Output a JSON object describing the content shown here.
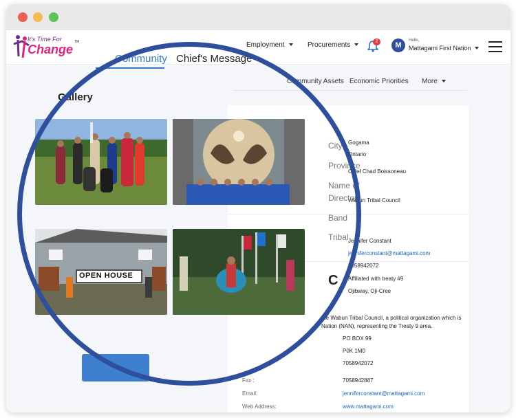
{
  "window": {
    "controls": [
      "close",
      "minimize",
      "maximize"
    ]
  },
  "logo": {
    "line1": "It's Time For",
    "line2": "Change",
    "tm": "TM"
  },
  "topnav": {
    "employment": "Employment",
    "procurements": "Procurements",
    "notification_count": "2",
    "hello": "Hello,",
    "org_name": "Mattagami First Nation"
  },
  "tabs": {
    "community": "Community",
    "chiefs_message": "Chief's Message"
  },
  "subnav": {
    "community_assets": "Community Assets",
    "economic_priorities": "Economic Priorities",
    "more": "More"
  },
  "gallery": {
    "title": "Gallery"
  },
  "details": {
    "city_label": "City",
    "province_label": "Province",
    "name_label": "Name of",
    "director_label": "Director",
    "band_label": "Band",
    "tribal_label": "Tribal",
    "first_value": "Gogama",
    "province_value": "Ontario",
    "name_value": "Chief Chad Boissoneau",
    "tribal_council_value": "Wabun Tribal Council",
    "contact_value": "Jennifer Constant",
    "email_value_top": "jenniferconstant@mattagami.com",
    "phone_value_top": "7058942072",
    "treaty_value": "Affiliated with treaty #9",
    "language_value": "Ojibway, Oji-Cree",
    "section_initial": "C"
  },
  "description": {
    "line1": "the Wabun Tribal Council, a political organization which is",
    "line2": "Nation (NAN), representing the Treaty 9 area."
  },
  "contact": {
    "address": "PO BOX 99",
    "postal": "P0K 1M0",
    "phone": "7058942072",
    "fax_label": "Fax :",
    "fax": "7058942887",
    "email_label": "Email:",
    "email": "jenniferconstant@mattagami.com",
    "web_label": "Web Address:",
    "web": "www.mattagami.com"
  },
  "photos": {
    "open_house_sign": "OPEN HOUSE"
  },
  "colors": {
    "accent": "#2f7bc8",
    "magnifier_ring": "#2d4f9c",
    "link": "#1a66c9",
    "badge": "#e23a3a"
  }
}
